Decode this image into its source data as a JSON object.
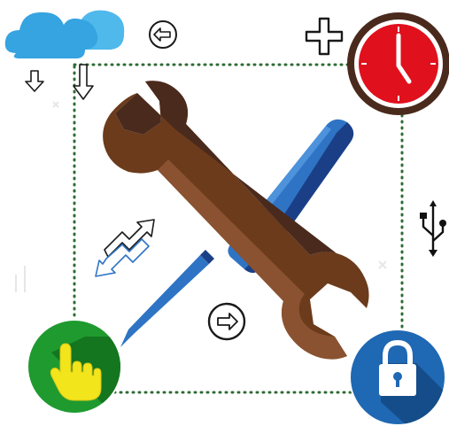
{
  "illustration": {
    "icons": [
      "cloud-icon",
      "arrow-down-icon",
      "circled-arrow-left-icon",
      "plus-icon",
      "clock-icon",
      "usb-icon",
      "wrench-icon",
      "screwdriver-icon",
      "trend-arrows-icon",
      "circled-arrow-right-icon",
      "pointing-hand-icon",
      "padlock-icon"
    ],
    "colors": {
      "cloud": "#35a4e0",
      "clock_face": "#e0101d",
      "clock_ring": "#4a2a1c",
      "wrench": "#6b3b1c",
      "screwdriver": "#2f74c4",
      "hand_button": "#1f9a2f",
      "hand": "#f3e51b",
      "lock_button": "#1f68b3",
      "dotted_frame": "#2f6b35"
    }
  }
}
